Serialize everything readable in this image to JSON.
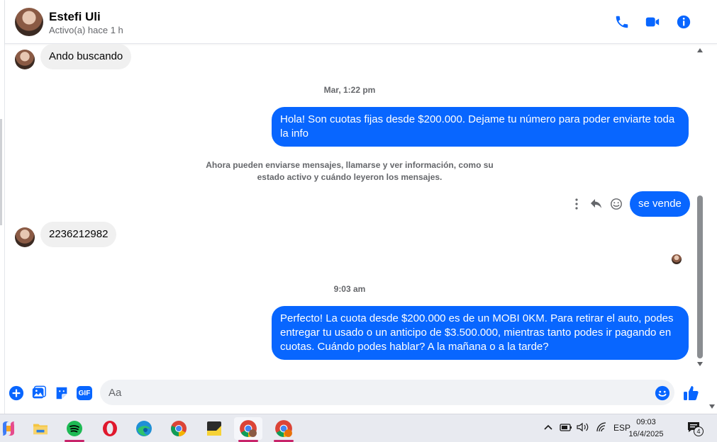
{
  "contact": {
    "name": "Estefi Uli",
    "status": "Activo(a) hace 1 h"
  },
  "header_icons": [
    "phone-icon",
    "video-call-icon",
    "info-icon"
  ],
  "messages": {
    "in_1": "Ando buscando",
    "time_1": "Mar, 1:22 pm",
    "out_1": "Hola! Son cuotas fijas desde $200.000. Dejame tu número para poder enviarte toda la info",
    "system": "Ahora pueden enviarse mensajes, llamarse y ver información, como su estado activo y cuándo leyeron los mensajes.",
    "out_2": "se vende",
    "in_2": "2236212982",
    "time_2": "9:03 am",
    "out_3": "Perfecto! La cuota desde $200.000 es de un MOBI 0KM. Para retirar el auto, podes entregar tu usado o un anticipo de $3.500.000, mientras tanto podes ir pagando en cuotas. Cuándo podes hablar? A la mañana o a la tarde?"
  },
  "composer": {
    "placeholder": "Aa",
    "icons": [
      "plus-icon",
      "image-icon",
      "sticker-icon",
      "gif-icon",
      "emoji-icon",
      "thumbs-up-icon"
    ],
    "gif_label": "GIF"
  },
  "taskbar": {
    "apps": [
      "copilot",
      "file-explorer",
      "spotify",
      "opera",
      "edge",
      "chrome",
      "sticky-notes",
      "chrome-profile-1",
      "chrome-profile-2"
    ],
    "language": "ESP",
    "time": "09:03",
    "date": "16/4/2025",
    "notification_count": "4"
  },
  "colors": {
    "accent": "#0866ff",
    "incoming_bubble": "#f0f0f0",
    "secondary_text": "#65676b"
  }
}
